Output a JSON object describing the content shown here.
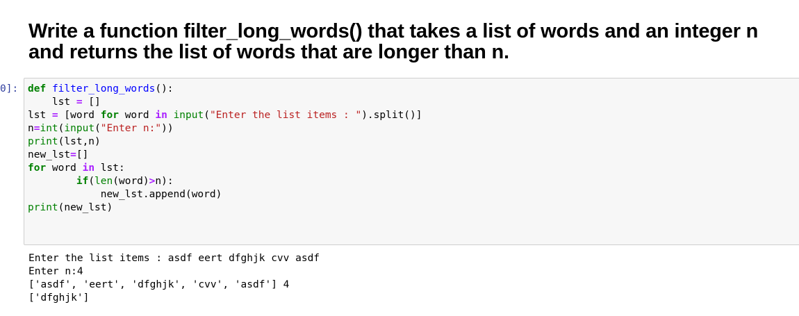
{
  "markdown": {
    "heading_line1": "Write a function filter_long_words() that takes a list of words and an integer n",
    "heading_line2": "and returns the list of words that are longer than n."
  },
  "code_cell": {
    "prompt": "0]:",
    "lines": [
      "def filter_long_words():",
      "    lst = []",
      "lst = [word for word in input(\"Enter the list items : \").split()]",
      "n=int(input(\"Enter n:\"))",
      "print(lst,n)",
      "new_lst=[]",
      "for word in lst:",
      "        if(len(word)>n):",
      "            new_lst.append(word)",
      "print(new_lst)"
    ],
    "tokens": {
      "def": "def",
      "func_name": "filter_long_words",
      "lst": "lst",
      "empty_list": "[]",
      "for": "for",
      "in": "in",
      "input": "input",
      "prompt_str1": "\"Enter the list items : \"",
      "split": ".split()]",
      "int": "int",
      "prompt_str2": "\"Enter n:\"",
      "print": "print",
      "new_lst": "new_lst",
      "if": "if",
      "len": "len",
      "append": "new_lst.append(word)"
    }
  },
  "output": {
    "lines": [
      "Enter the list items : asdf eert dfghjk cvv asdf",
      "Enter n:4",
      "['asdf', 'eert', 'dfghjk', 'cvv', 'asdf'] 4",
      "['dfghjk']"
    ]
  }
}
